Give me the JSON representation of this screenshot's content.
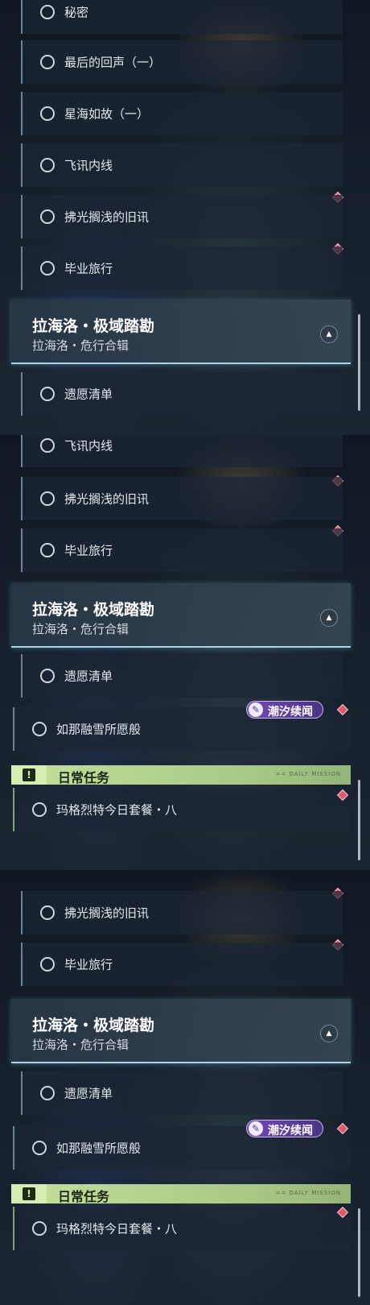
{
  "quests": {
    "secret": "秘密",
    "final_echo": "最后的回声（一）",
    "star_sea": "星海如故（一）",
    "feixun": "飞讯内线",
    "old_news": "拂光搁浅的旧讯",
    "graduation": "毕业旅行",
    "wish_list": "遗愿清单",
    "snow_wish": "如那融雪所愿般",
    "daily_item": "玛格烈特今日套餐・八"
  },
  "banner": {
    "title": "拉海洛・极域踏勘",
    "subtitle": "拉海洛・危行合辑",
    "toggle_icon": "triangle-up-icon"
  },
  "tag": {
    "label": "潮汐续闻",
    "icon": "feather-icon"
  },
  "daily": {
    "header": "日常任务",
    "icon": "exclamation-icon",
    "deco": "== DAILY MISSION"
  },
  "colors": {
    "accent_red": "#e2586a",
    "daily_green": "#c3df9c",
    "tag_purple": "#6f4ab8",
    "banner_glow": "#a8d4e6"
  }
}
